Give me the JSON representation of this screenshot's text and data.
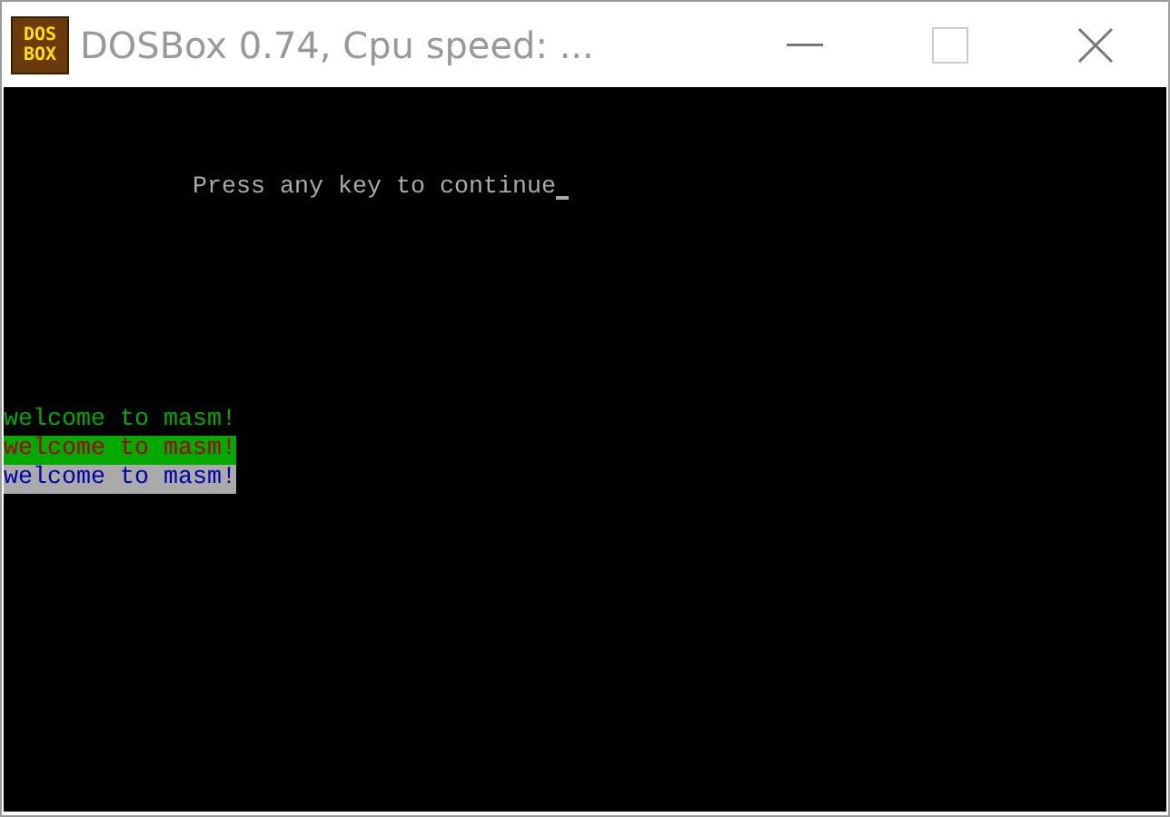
{
  "window": {
    "title": "DOSBox 0.74, Cpu speed: ...",
    "app_icon_text": [
      "DOS",
      "BOX"
    ]
  },
  "screen": {
    "prompt": {
      "text": "Press any key to continue",
      "cursor": true
    },
    "lines": [
      {
        "text": "welcome to masm!",
        "kind": "plain"
      },
      {
        "text": "welcome to masm!",
        "kind": "highlighted"
      },
      {
        "text": "welcome to masm!",
        "kind": "inverted"
      }
    ]
  }
}
